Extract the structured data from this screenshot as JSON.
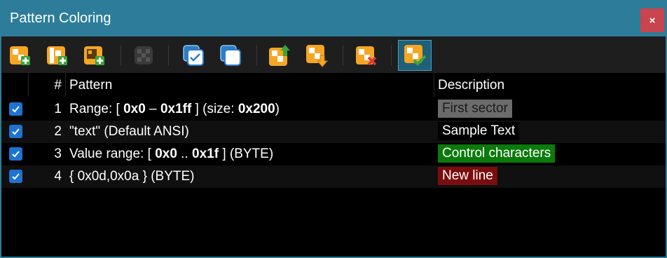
{
  "window": {
    "title": "Pattern Coloring",
    "close_label": "×"
  },
  "toolbar": {
    "buttons": [
      {
        "name": "add-pattern-icon"
      },
      {
        "name": "add-pattern-from-selection-icon"
      },
      {
        "name": "add-pattern-from-template-icon"
      },
      {
        "name": "disable-pattern-icon"
      },
      {
        "name": "select-all-icon"
      },
      {
        "name": "deselect-all-icon"
      },
      {
        "name": "move-up-icon"
      },
      {
        "name": "move-down-icon"
      },
      {
        "name": "delete-pattern-icon"
      },
      {
        "name": "apply-coloring-icon"
      }
    ]
  },
  "table": {
    "headers": {
      "num": "#",
      "pattern": "Pattern",
      "description": "Description"
    },
    "rows": [
      {
        "num": "1",
        "pattern_parts": [
          "Range: [ ",
          "0x0",
          " – ",
          "0x1ff",
          " ] (size: ",
          "0x200",
          ")"
        ],
        "description": "First sector",
        "bg": "#6b6b6b",
        "fg": "#1c1c1c"
      },
      {
        "num": "2",
        "pattern": "\"text\" (Default ANSI)",
        "description": "Sample Text",
        "bg": "#000000",
        "fg": "#ffffff"
      },
      {
        "num": "3",
        "pattern_parts": [
          "Value range: [ ",
          "0x0",
          " .. ",
          "0x1f",
          " ] (BYTE)"
        ],
        "description": "Control characters",
        "bg": "#0b7a0b",
        "fg": "#ffffff"
      },
      {
        "num": "4",
        "pattern": "{ 0x0d,0x0a } (BYTE)",
        "description": "New line",
        "bg": "#7a0d0d",
        "fg": "#ffffff"
      }
    ]
  }
}
